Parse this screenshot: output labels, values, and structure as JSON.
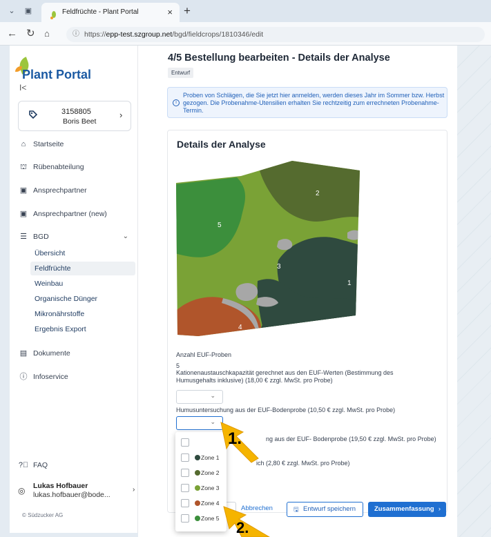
{
  "browser": {
    "tab_title": "Feldfrüchte - Plant Portal",
    "url_prefix": "https://",
    "url_host": "epp-test.szgroup.net",
    "url_path": "/bgd/fieldcrops/1810346/edit"
  },
  "sidebar": {
    "logo_text": "Plant Portal",
    "collapse_glyph": "I<",
    "account": {
      "number": "3158805",
      "name": "Boris Beet"
    },
    "nav": [
      {
        "label": "Startseite",
        "icon": "home-icon"
      },
      {
        "label": "Rübenabteilung",
        "icon": "farm-icon"
      },
      {
        "label": "Ansprechpartner",
        "icon": "contact-icon"
      },
      {
        "label": "Ansprechpartner (new)",
        "icon": "contact-icon"
      },
      {
        "label": "BGD",
        "icon": "database-icon"
      }
    ],
    "bgd_sub": [
      "Übersicht",
      "Feldfrüchte",
      "Weinbau",
      "Organische Dünger",
      "Mikronährstoffe",
      "Ergebnis Export"
    ],
    "nav_bottom": [
      {
        "label": "Dokumente",
        "icon": "document-icon"
      },
      {
        "label": "Infoservice",
        "icon": "info-icon"
      }
    ],
    "faq": "FAQ",
    "user": {
      "name": "Lukas Hofbauer",
      "email": "lukas.hofbauer@bode..."
    },
    "copyright": "© Südzucker AG"
  },
  "main": {
    "title": "4/5 Bestellung bearbeiten - Details der Analyse",
    "status_badge": "Entwurf",
    "info_text": "Proben von Schlägen, die Sie jetzt hier anmelden, werden dieses Jahr im Sommer bzw. Herbst gezogen. Die Probenahme-Utensilien erhalten Sie rechtzeitig zum errechneten Probenahme-Termin.",
    "card_title": "Details der Analyse",
    "map_zone_labels": [
      "1",
      "2",
      "3",
      "4",
      "5"
    ],
    "anzahl_label": "Anzahl EUF-Proben",
    "anzahl_value": "5",
    "kak_label": "Kationenaustauschkapazität gerechnet aus den EUF-Werten (Bestimmung des Humusgehalts inklusive) (18,00 € zzgl. MwSt. pro Probe)",
    "humus_label": "Humusuntersuchung aus der EUF-Bodenprobe (10,50 € zzgl. MwSt. pro Probe)",
    "third_label_tail": "ng aus der EUF- Bodenprobe (19,50 € zzgl. MwSt. pro Probe)",
    "fourth_label_tail": "ich (2,80 € zzgl. MwSt. pro Probe)",
    "dropdown_options": [
      {
        "label": "Zone 1",
        "color": "#2f4a3f"
      },
      {
        "label": "Zone 2",
        "color": "#556b2f"
      },
      {
        "label": "Zone 3",
        "color": "#7aa236"
      },
      {
        "label": "Zone 4",
        "color": "#b0552b"
      },
      {
        "label": "Zone 5",
        "color": "#3c8f3c"
      }
    ],
    "cancel_label": "Abbrechen",
    "draft_label": "Entwurf speichern",
    "summary_label": "Zusammenfassung",
    "summary_arrow": "›"
  },
  "annotations": {
    "step1": "1.",
    "step2": "2."
  }
}
